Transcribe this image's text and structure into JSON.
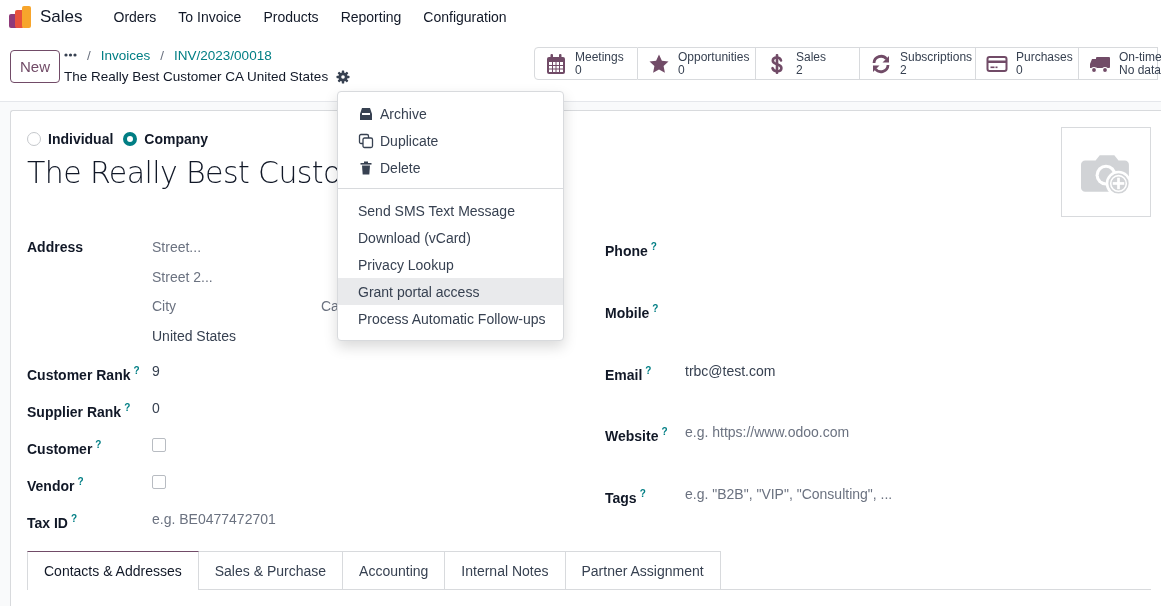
{
  "app": {
    "name": "Sales",
    "menu": [
      "Orders",
      "To Invoice",
      "Products",
      "Reporting",
      "Configuration"
    ]
  },
  "control_panel": {
    "new_button": "New",
    "breadcrumbs": [
      {
        "separator": "/",
        "label": "Invoices"
      },
      {
        "separator": "/",
        "label": "INV/2023/00018"
      }
    ],
    "record_title": "The Really Best Customer CA United States"
  },
  "stat_buttons": [
    {
      "kind": "calendar",
      "label": "Meetings",
      "value": "0"
    },
    {
      "kind": "star",
      "label": "Opportunities",
      "value": "0"
    },
    {
      "kind": "dollar",
      "label": "Sales",
      "value": "2"
    },
    {
      "kind": "refresh",
      "label": "Subscriptions",
      "value": "2"
    },
    {
      "kind": "card",
      "label": "Purchases",
      "value": "0"
    },
    {
      "kind": "truck",
      "label": "On-time",
      "value": "No data"
    }
  ],
  "actions_menu": {
    "sections": [
      {
        "items": [
          {
            "kind": "archive",
            "label": "Archive",
            "highlighted": false
          },
          {
            "kind": "copy",
            "label": "Duplicate",
            "highlighted": false
          },
          {
            "kind": "trash",
            "label": "Delete",
            "highlighted": false
          }
        ]
      },
      {
        "items": [
          {
            "kind": "plain",
            "label": "Send SMS Text Message",
            "highlighted": false
          },
          {
            "kind": "plain",
            "label": "Download (vCard)",
            "highlighted": false
          },
          {
            "kind": "plain",
            "label": "Privacy Lookup",
            "highlighted": false
          },
          {
            "kind": "plain",
            "label": "Grant portal access",
            "highlighted": true
          },
          {
            "kind": "plain",
            "label": "Process Automatic Follow-ups",
            "highlighted": false
          }
        ]
      }
    ]
  },
  "form": {
    "company_type": [
      {
        "label": "Individual",
        "selected": false
      },
      {
        "label": "Company",
        "selected": true
      }
    ],
    "name": "The Really Best Custo",
    "address": {
      "label": "Address",
      "street": {
        "placeholder": "Street..."
      },
      "street2": {
        "placeholder": "Street 2..."
      },
      "city": {
        "placeholder": "City"
      },
      "state": {
        "placeholder": "Ca"
      },
      "country": {
        "value": "United States"
      }
    },
    "left_fields": [
      {
        "kind": "text",
        "label": "Customer Rank",
        "help": "?",
        "value": "9"
      },
      {
        "kind": "text",
        "label": "Supplier Rank",
        "help": "?",
        "value": "0"
      },
      {
        "kind": "checkbox",
        "label": "Customer",
        "help": "?",
        "checked": false
      },
      {
        "kind": "checkbox",
        "label": "Vendor",
        "help": "?",
        "checked": false
      },
      {
        "kind": "text",
        "label": "Tax ID",
        "help": "?",
        "placeholder": "e.g. BE0477472701"
      }
    ],
    "right_fields": [
      {
        "kind": "text",
        "label": "Phone",
        "help": "?"
      },
      {
        "kind": "text",
        "label": "Mobile",
        "help": "?"
      },
      {
        "kind": "text",
        "label": "Email",
        "help": "?",
        "value": "trbc@test.com"
      },
      {
        "kind": "text",
        "label": "Website",
        "help": "?",
        "placeholder": "e.g. https://www.odoo.com"
      },
      {
        "kind": "text",
        "label": "Tags",
        "help": "?",
        "placeholder": "e.g. \"B2B\", \"VIP\", \"Consulting\", ..."
      }
    ],
    "tabs": [
      {
        "label": "Contacts & Addresses",
        "selected": true
      },
      {
        "label": "Sales & Purchase",
        "selected": false
      },
      {
        "label": "Accounting",
        "selected": false
      },
      {
        "label": "Internal Notes",
        "selected": false
      },
      {
        "label": "Partner Assignment",
        "selected": false
      }
    ]
  }
}
